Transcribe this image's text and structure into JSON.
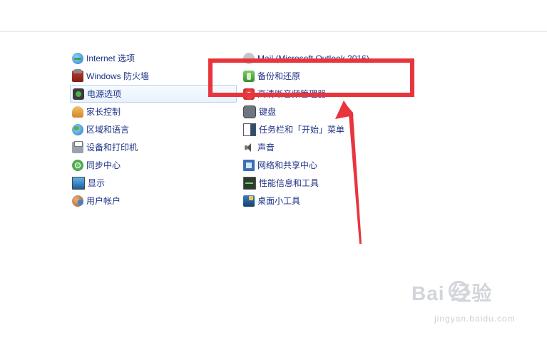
{
  "left_items": [
    {
      "label": "Internet 选项",
      "icon": "internet-options-icon"
    },
    {
      "label": "Windows 防火墙",
      "icon": "firewall-icon"
    },
    {
      "label": "电源选项",
      "icon": "power-options-icon",
      "selected": true
    },
    {
      "label": "家长控制",
      "icon": "parental-controls-icon"
    },
    {
      "label": "区域和语言",
      "icon": "region-language-icon"
    },
    {
      "label": "设备和打印机",
      "icon": "printer-icon"
    },
    {
      "label": "同步中心",
      "icon": "sync-center-icon"
    },
    {
      "label": "显示",
      "icon": "display-icon"
    },
    {
      "label": "用户帐户",
      "icon": "user-accounts-icon"
    }
  ],
  "right_items": [
    {
      "label": "Mail (Microsoft Outlook 2016)",
      "icon": "mail-icon"
    },
    {
      "label": "备份和还原",
      "icon": "backup-restore-icon"
    },
    {
      "label": "高清晰音频管理器",
      "icon": "hd-audio-icon"
    },
    {
      "label": "键盘",
      "icon": "keyboard-icon"
    },
    {
      "label": "任务栏和「开始」菜单",
      "icon": "taskbar-icon"
    },
    {
      "label": "声音",
      "icon": "sound-icon"
    },
    {
      "label": "网络和共享中心",
      "icon": "network-icon"
    },
    {
      "label": "性能信息和工具",
      "icon": "performance-icon"
    },
    {
      "label": "桌面小工具",
      "icon": "gadgets-icon"
    }
  ],
  "annotation": {
    "color": "#e8353d"
  },
  "watermark": {
    "logo": "Bai  经验",
    "url": "jingyan.baidu.com"
  }
}
